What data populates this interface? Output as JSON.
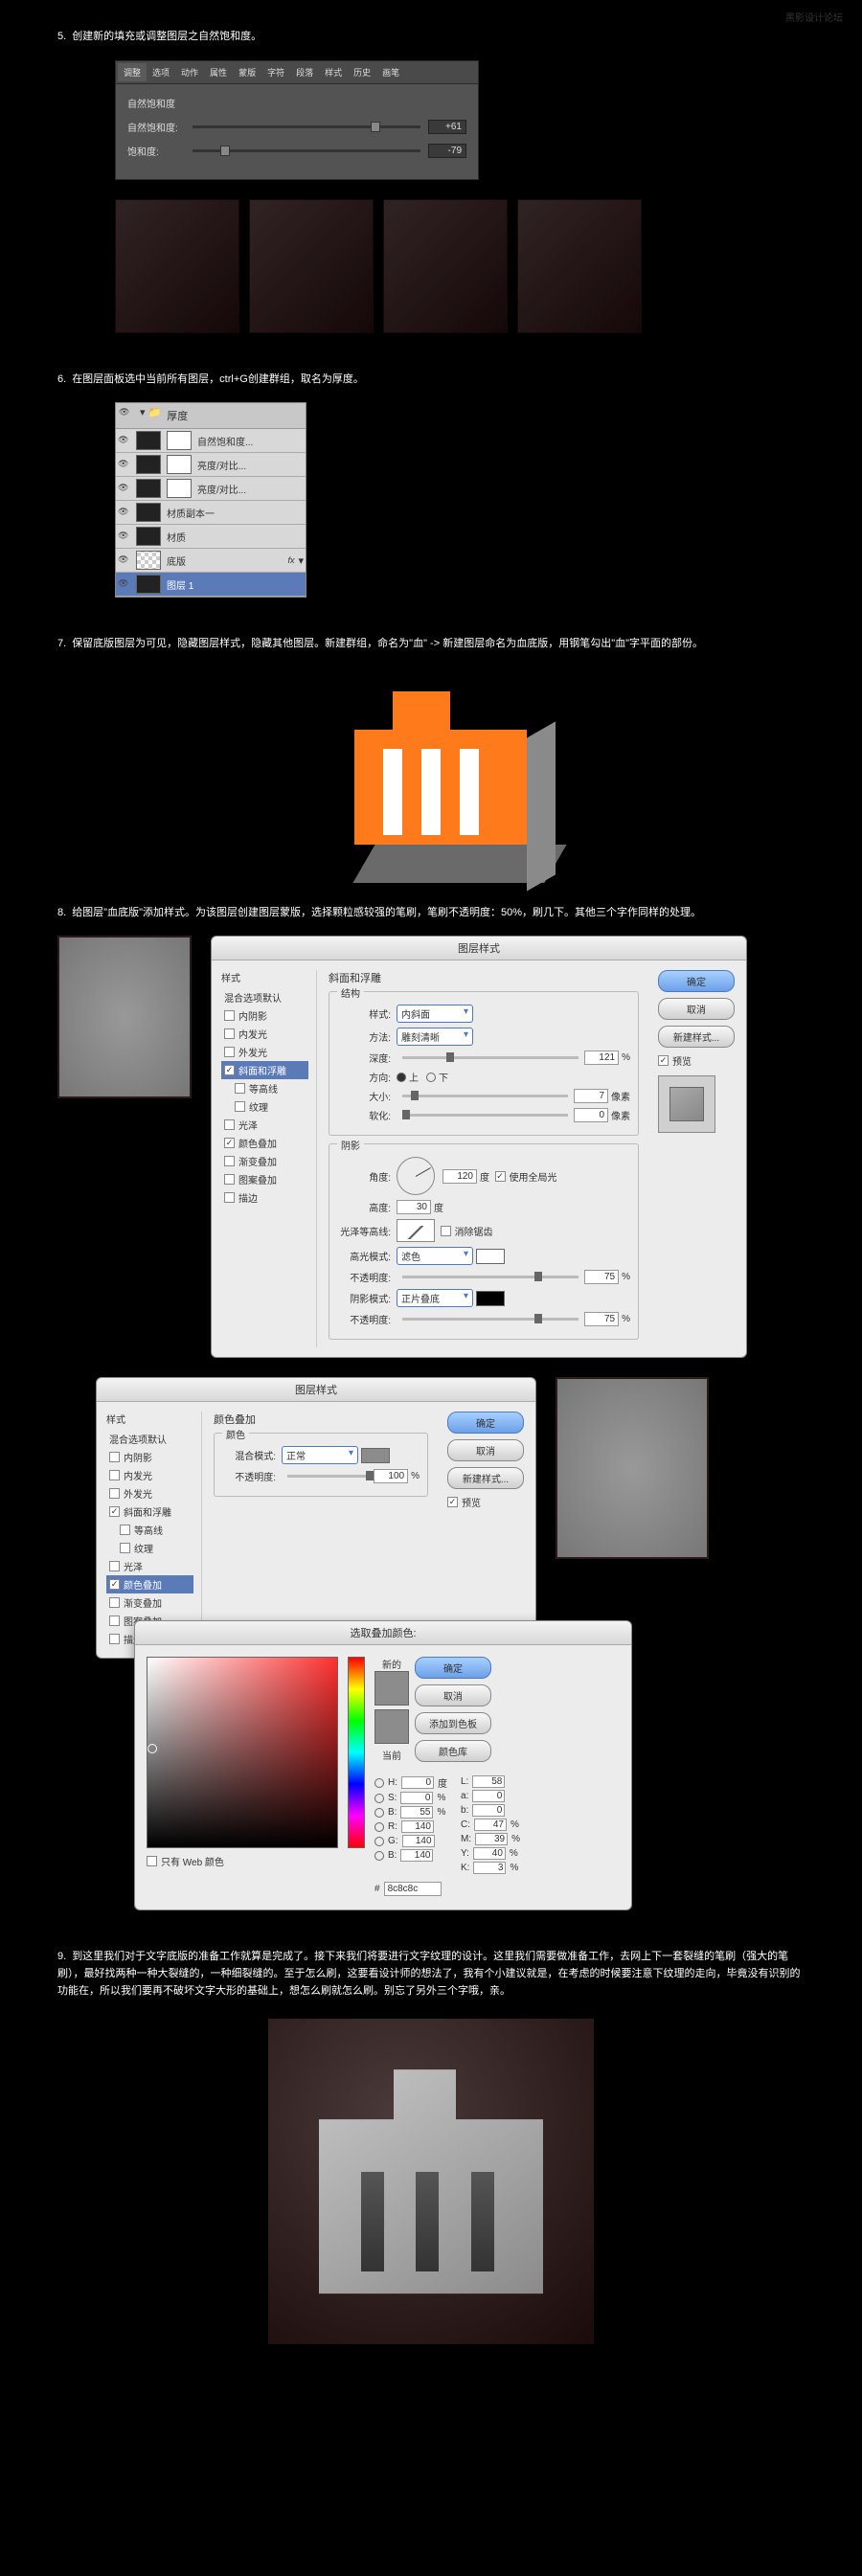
{
  "watermark": "黑影设计论坛",
  "step5": {
    "num": "5.",
    "text": "创建新的填充或调整图层之自然饱和度。",
    "tabs": [
      "调整",
      "选项",
      "动作",
      "属性",
      "蒙版",
      "字符",
      "段落",
      "样式",
      "历史",
      "画笔"
    ],
    "title": "自然饱和度",
    "row1_label": "自然饱和度:",
    "row1_val": "+61",
    "row2_label": "饱和度:",
    "row2_val": "-79"
  },
  "step6": {
    "num": "6.",
    "text": "在图层面板选中当前所有图层，ctrl+G创建群组，取名为厚度。",
    "folder": "厚度",
    "layers": [
      {
        "name": "自然饱和度..."
      },
      {
        "name": "亮度/对比..."
      },
      {
        "name": "亮度/对比..."
      },
      {
        "name": "材质副本一"
      },
      {
        "name": "材质"
      },
      {
        "name": "底版",
        "fx": "fx"
      },
      {
        "name": "图层 1"
      }
    ]
  },
  "step7": {
    "num": "7.",
    "text": "保留底版图层为可见，隐藏图层样式，隐藏其他图层。新建群组，命名为\"血\" -> 新建图层命名为血底版，用钢笔勾出\"血\"字平面的部份。"
  },
  "step8": {
    "num": "8.",
    "text": "给图层\"血底版\"添加样式。为该图层创建图层蒙版，选择颗粒感较强的笔刷，笔刷不透明度：50%，刷几下。其他三个字作同样的处理。",
    "dlg_title": "图层样式",
    "left_header": "样式",
    "left_sub": "混合选项默认",
    "left_items": [
      {
        "label": "内阴影",
        "on": false
      },
      {
        "label": "内发光",
        "on": false
      },
      {
        "label": "外发光",
        "on": false
      },
      {
        "label": "斜面和浮雕",
        "on": true,
        "sel": true
      },
      {
        "label": "等高线",
        "on": false,
        "indent": true
      },
      {
        "label": "纹理",
        "on": false,
        "indent": true
      },
      {
        "label": "光泽",
        "on": false
      },
      {
        "label": "颜色叠加",
        "on": true
      },
      {
        "label": "渐变叠加",
        "on": false
      },
      {
        "label": "图案叠加",
        "on": false
      },
      {
        "label": "描边",
        "on": false
      }
    ],
    "bevel": {
      "grp1": "结构",
      "style_l": "样式:",
      "style_v": "内斜面",
      "tech_l": "方法:",
      "tech_v": "雕刻清晰",
      "depth_l": "深度:",
      "depth_v": "121",
      "depth_u": "%",
      "dir_l": "方向:",
      "dir_up": "上",
      "dir_down": "下",
      "size_l": "大小:",
      "size_v": "7",
      "size_u": "像素",
      "soft_l": "软化:",
      "soft_v": "0",
      "soft_u": "像素",
      "grp2": "阴影",
      "angle_l": "角度:",
      "angle_v": "120",
      "angle_u": "度",
      "global": "使用全局光",
      "alt_l": "高度:",
      "alt_v": "30",
      "alt_u": "度",
      "gloss_l": "光泽等高线:",
      "anti": "消除锯齿",
      "hmode_l": "高光模式:",
      "hmode_v": "滤色",
      "hop_l": "不透明度:",
      "hop_v": "75",
      "hop_u": "%",
      "smode_l": "阴影模式:",
      "smode_v": "正片叠底",
      "sop_l": "不透明度:",
      "sop_v": "75",
      "sop_u": "%"
    },
    "btn_ok": "确定",
    "btn_cancel": "取消",
    "btn_new": "新建样式...",
    "btn_preview": "预览"
  },
  "step8b": {
    "dlg_title": "图层样式",
    "grp": "颜色叠加",
    "sub": "颜色",
    "blend_l": "混合模式:",
    "blend_v": "正常",
    "op_l": "不透明度:",
    "op_v": "100",
    "op_u": "%",
    "sel_item": "颜色叠加"
  },
  "picker": {
    "title": "选取叠加颜色:",
    "new_l": "新的",
    "cur_l": "当前",
    "btn_ok": "确定",
    "btn_cancel": "取消",
    "btn_add": "添加到色板",
    "btn_lib": "颜色库",
    "H_l": "H:",
    "H_v": "0",
    "H_u": "度",
    "S_l": "S:",
    "S_v": "0",
    "S_u": "%",
    "B_l": "B:",
    "B_v": "55",
    "B_u": "%",
    "R_l": "R:",
    "R_v": "140",
    "G_l": "G:",
    "G_v": "140",
    "Bch_l": "B:",
    "Bch_v": "140",
    "L_l": "L:",
    "L_v": "58",
    "a_l": "a:",
    "a_v": "0",
    "b_l": "b:",
    "b_v": "0",
    "C_l": "C:",
    "C_v": "47",
    "C_u": "%",
    "M_l": "M:",
    "M_v": "39",
    "M_u": "%",
    "Y_l": "Y:",
    "Y_v": "40",
    "Y_u": "%",
    "K_l": "K:",
    "K_v": "3",
    "K_u": "%",
    "hex_l": "#",
    "hex_v": "8c8c8c",
    "webonly": "只有 Web 颜色"
  },
  "step9": {
    "num": "9.",
    "text": "到这里我们对于文字底版的准备工作就算是完成了。接下来我们将要进行文字纹理的设计。这里我们需要做准备工作，去网上下一套裂缝的笔刷（强大的笔刷），最好找两种一种大裂缝的，一种细裂缝的。至于怎么刷，这要看设计师的想法了，我有个小建议就是，在考虑的时候要注意下纹理的走向，毕竟没有识别的功能在，所以我们要再不破坏文字大形的基础上，想怎么刷就怎么刷。别忘了另外三个字哦，亲。"
  }
}
